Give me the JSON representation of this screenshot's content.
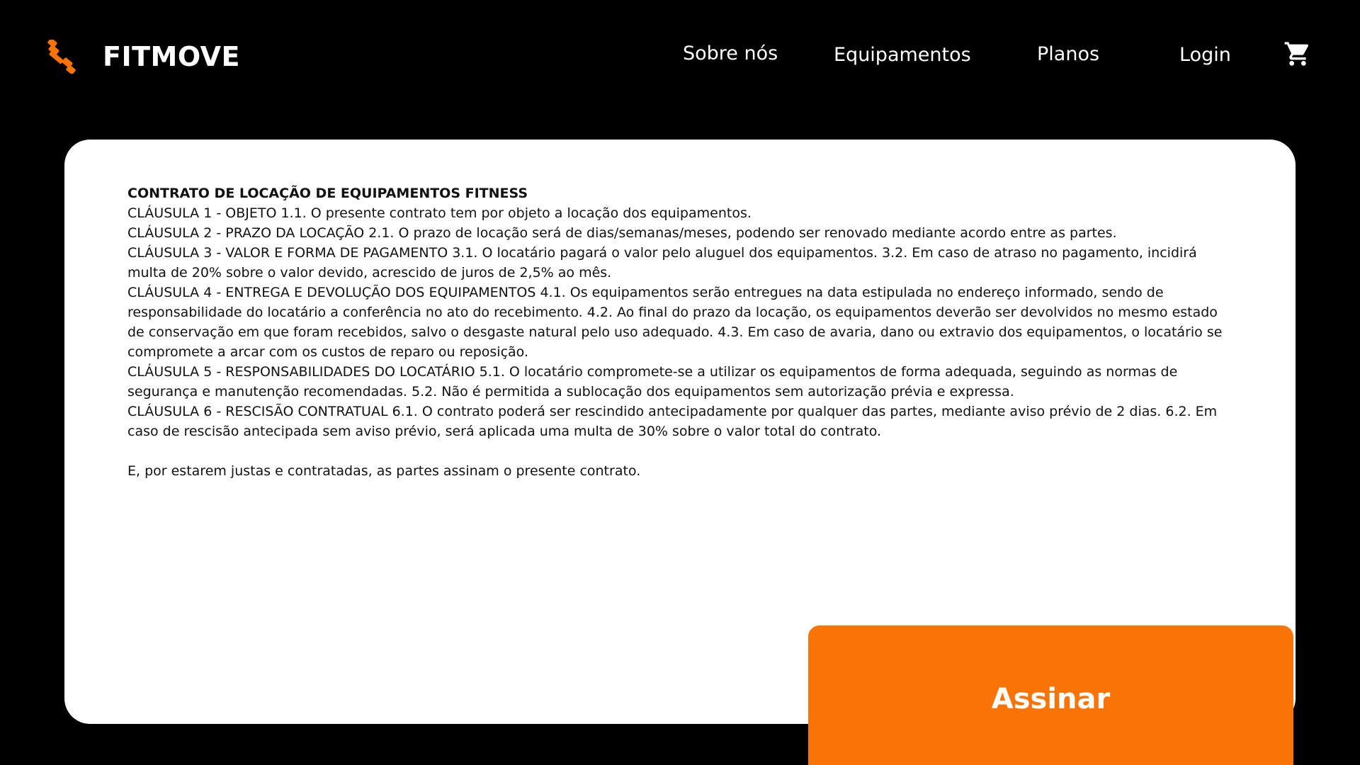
{
  "header": {
    "brand": "FITMOVE",
    "logo_icon": "dumbbell-icon",
    "nav": {
      "about": "Sobre nós",
      "equipment": "Equipamentos",
      "plans": "Planos",
      "login": "Login"
    },
    "cart_icon": "shopping-cart-icon"
  },
  "contract": {
    "title": "CONTRATO DE LOCAÇÃO DE EQUIPAMENTOS FITNESS",
    "clauses": [
      "CLÁUSULA 1 - OBJETO 1.1. O presente contrato tem por objeto a locação dos equipamentos.",
      "CLÁUSULA 2 - PRAZO DA LOCAÇÃO 2.1. O prazo de locação será de dias/semanas/meses, podendo ser renovado mediante acordo entre as partes.",
      "CLÁUSULA 3 - VALOR E FORMA DE PAGAMENTO 3.1. O locatário pagará o valor pelo aluguel dos equipamentos. 3.2. Em caso de atraso no pagamento, incidirá multa de 20% sobre o valor devido, acrescido de juros de 2,5% ao mês.",
      "CLÁUSULA 4 - ENTREGA E DEVOLUÇÃO DOS EQUIPAMENTOS 4.1. Os equipamentos serão entregues na data estipulada no endereço informado, sendo de responsabilidade do locatário a conferência no ato do recebimento. 4.2. Ao final do prazo da locação, os equipamentos deverão ser devolvidos no mesmo estado de conservação em que foram recebidos, salvo o desgaste natural pelo uso adequado. 4.3. Em caso de avaria, dano ou extravio dos equipamentos, o locatário se compromete a arcar com os custos de reparo ou reposição.",
      "CLÁUSULA 5 - RESPONSABILIDADES DO LOCATÁRIO 5.1. O locatário compromete-se a utilizar os equipamentos de forma adequada, seguindo as normas de segurança e manutenção recomendadas. 5.2. Não é permitida a sublocação dos equipamentos sem autorização prévia e expressa.",
      "CLÁUSULA 6 - RESCISÃO CONTRATUAL 6.1. O contrato poderá ser rescindido antecipadamente por qualquer das partes, mediante aviso prévio de 2 dias. 6.2. Em caso de rescisão antecipada sem aviso prévio, será aplicada uma multa de 30% sobre o valor total do contrato."
    ],
    "closing": "E, por estarem justas e contratadas, as partes assinam o presente contrato."
  },
  "actions": {
    "sign_label": "Assinar"
  },
  "colors": {
    "background": "#000000",
    "card": "#ffffff",
    "accent": "#f97306",
    "text": "#111111"
  }
}
